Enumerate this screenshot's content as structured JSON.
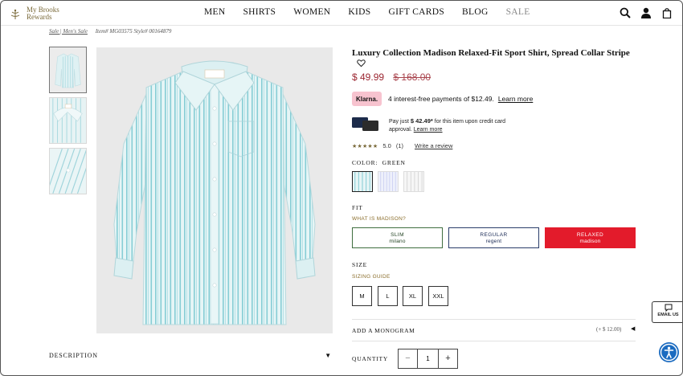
{
  "header": {
    "logo": {
      "line1": "My Brooks",
      "line2": "Rewards"
    },
    "nav": [
      "MEN",
      "SHIRTS",
      "WOMEN",
      "KIDS",
      "GIFT CARDS",
      "BLOG",
      "SALE"
    ],
    "icons": [
      "search-icon",
      "account-icon",
      "bag-icon"
    ]
  },
  "breadcrumb": {
    "links": "Sale | Men's Sale",
    "item": "Item# MG03575 Style# 00164879"
  },
  "gallery": {
    "thumbnail_count": 3,
    "description_label": "DESCRIPTION",
    "description_chevron": "▼"
  },
  "product": {
    "title": "Luxury Collection Madison Relaxed-Fit Sport Shirt, Spread Collar Stripe",
    "price_now": "$ 49.99",
    "price_was": "$ 168.00",
    "price_color": "#9b2530",
    "klarna": {
      "badge": "Klarna.",
      "text": "4 interest-free payments of $12.49.",
      "link": "Learn more"
    },
    "credit": {
      "line1_pre": "Pay just ",
      "line1_amount": "$ 42.49*",
      "line1_post": " for this item upon credit card",
      "line2_pre": "approval. ",
      "line2_link": "Learn more"
    },
    "rating": {
      "stars": "★★★★★",
      "score": "5.0",
      "count": "(1)",
      "review_link": "Write a review"
    },
    "color": {
      "label": "COLOR:",
      "value": "GREEN",
      "swatches": [
        "green-stripe",
        "blue-check",
        "gray-stripe"
      ]
    },
    "fit": {
      "label": "FIT",
      "link": "WHAT IS MADISON?",
      "options": [
        {
          "name": "SLIM",
          "sub": "milano"
        },
        {
          "name": "REGULAR",
          "sub": "regent"
        },
        {
          "name": "RELAXED",
          "sub": "madison",
          "selected": true
        }
      ],
      "selected_color": "#e31b2b"
    },
    "size": {
      "label": "SIZE",
      "link": "SIZING GUIDE",
      "options": [
        "M",
        "L",
        "XL",
        "XXL"
      ]
    },
    "monogram": {
      "label": "ADD A MONOGRAM",
      "price": "(+ $ 12.00)",
      "chevron": "◀"
    },
    "quantity": {
      "label": "QUANTITY",
      "minus": "−",
      "value": "1",
      "plus": "+"
    }
  },
  "widgets": {
    "email_us": "EMAIL US",
    "accessibility": "accessibility-icon"
  }
}
